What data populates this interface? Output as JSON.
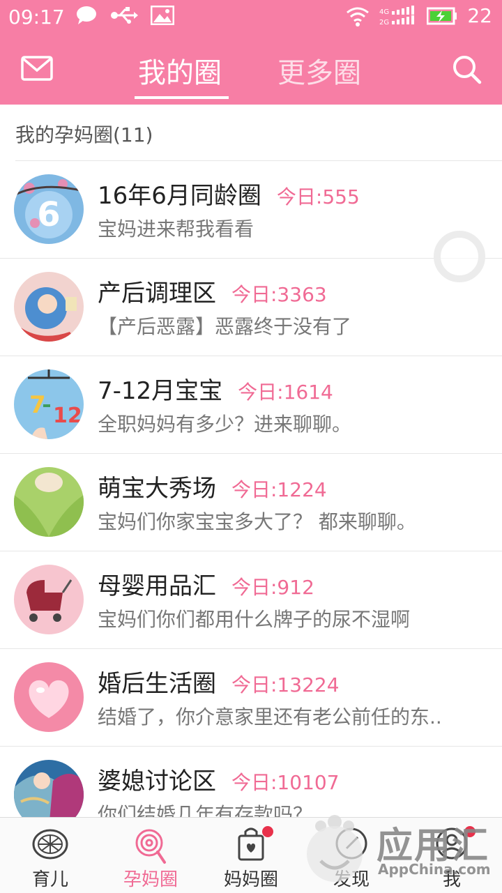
{
  "status_bar": {
    "time": "09:17",
    "battery": "22",
    "network": "4G"
  },
  "header": {
    "tabs": [
      {
        "label": "我的圈",
        "active": true
      },
      {
        "label": "更多圈",
        "active": false
      }
    ],
    "left_icon": "mail-icon",
    "right_icon": "search-icon",
    "bg_color": "#f77ea5"
  },
  "section": {
    "title": "我的孕妈圈(11)"
  },
  "circles": [
    {
      "name": "16年6月同龄圈",
      "today": "今日:555",
      "desc": "宝妈进来帮我看看"
    },
    {
      "name": "产后调理区",
      "today": "今日:3363",
      "desc": "【产后恶露】恶露终于没有了"
    },
    {
      "name": "7-12月宝宝",
      "today": "今日:1614",
      "desc": "全职妈妈有多少？进来聊聊。"
    },
    {
      "name": "萌宝大秀场",
      "today": "今日:1224",
      "desc": "宝妈们你家宝宝多大了？ 都来聊聊。"
    },
    {
      "name": "母婴用品汇",
      "today": "今日:912",
      "desc": "宝妈们你们都用什么牌子的尿不湿啊"
    },
    {
      "name": "婚后生活圈",
      "today": "今日:13224",
      "desc": "结婚了，你介意家里还有老公前任的东.."
    },
    {
      "name": "婆媳讨论区",
      "today": "今日:10107",
      "desc": "你们结婚几年有存款吗？"
    }
  ],
  "bottom_nav": [
    {
      "label": "育儿",
      "icon": "lemon-icon",
      "active": false
    },
    {
      "label": "孕妈圈",
      "icon": "lollipop-icon",
      "active": true
    },
    {
      "label": "妈妈圈",
      "icon": "bag-icon",
      "active": false,
      "badge": true
    },
    {
      "label": "发现",
      "icon": "compass-icon",
      "active": false
    },
    {
      "label": "我",
      "icon": "profile-icon",
      "active": false,
      "badge": true
    }
  ],
  "watermark": {
    "title": "应用汇",
    "sub": "AppChina.com"
  },
  "accent_color": "#f06a94"
}
